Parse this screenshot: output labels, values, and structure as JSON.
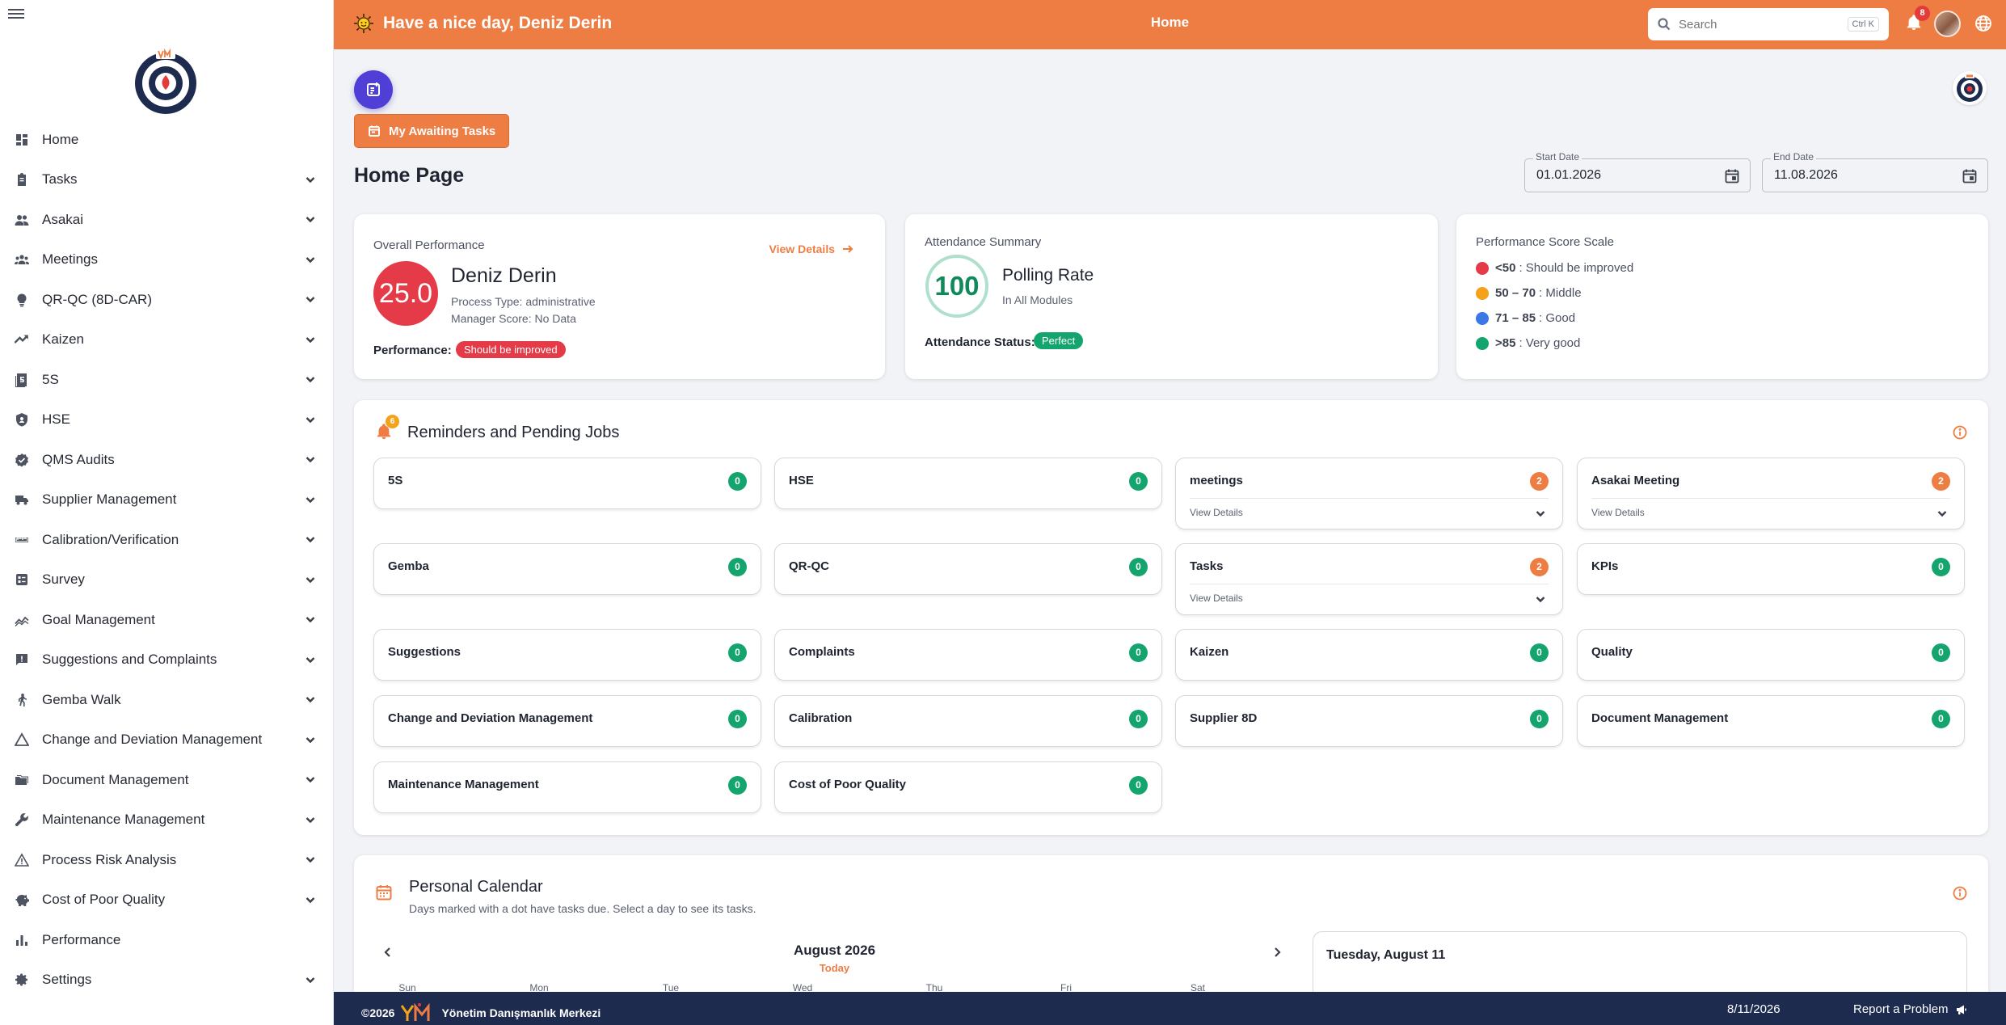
{
  "header": {
    "greeting": "Have a nice day, Deniz Derin",
    "title": "Home",
    "search_placeholder": "Search",
    "search_shortcut": "Ctrl K",
    "notification_count": "8"
  },
  "sidebar": {
    "items": [
      {
        "label": "Home",
        "icon": "dashboard-icon",
        "has_children": false
      },
      {
        "label": "Tasks",
        "icon": "clipboard-icon",
        "has_children": true
      },
      {
        "label": "Asakai",
        "icon": "people-icon",
        "has_children": true
      },
      {
        "label": "Meetings",
        "icon": "groups-icon",
        "has_children": true
      },
      {
        "label": "QR-QC (8D-CAR)",
        "icon": "lightbulb-icon",
        "has_children": true
      },
      {
        "label": "Kaizen",
        "icon": "trending-up-icon",
        "has_children": true
      },
      {
        "label": "5S",
        "icon": "five-icon",
        "has_children": true
      },
      {
        "label": "HSE",
        "icon": "shield-icon",
        "has_children": true
      },
      {
        "label": "QMS Audits",
        "icon": "verified-icon",
        "has_children": true
      },
      {
        "label": "Supplier Management",
        "icon": "truck-icon",
        "has_children": true
      },
      {
        "label": "Calibration/Verification",
        "icon": "ruler-icon",
        "has_children": true
      },
      {
        "label": "Survey",
        "icon": "survey-icon",
        "has_children": true
      },
      {
        "label": "Goal Management",
        "icon": "chart-line-icon",
        "has_children": true
      },
      {
        "label": "Suggestions and Complaints",
        "icon": "feedback-icon",
        "has_children": true
      },
      {
        "label": "Gemba Walk",
        "icon": "walk-icon",
        "has_children": true
      },
      {
        "label": "Change and Deviation Management",
        "icon": "triangle-icon",
        "has_children": true
      },
      {
        "label": "Document Management",
        "icon": "folder-icon",
        "has_children": true
      },
      {
        "label": "Maintenance Management",
        "icon": "wrench-icon",
        "has_children": true
      },
      {
        "label": "Process Risk Analysis",
        "icon": "warning-icon",
        "has_children": true
      },
      {
        "label": "Cost of Poor Quality",
        "icon": "piggy-bank-icon",
        "has_children": true
      },
      {
        "label": "Performance",
        "icon": "bar-chart-icon",
        "has_children": false
      },
      {
        "label": "Settings",
        "icon": "gear-icon",
        "has_children": true
      }
    ]
  },
  "main": {
    "awaiting_tasks_label": "My Awaiting Tasks",
    "page_title": "Home Page",
    "start_date": {
      "label": "Start Date",
      "value": "01.01.2026"
    },
    "end_date": {
      "label": "End Date",
      "value": "11.08.2026"
    }
  },
  "performance": {
    "title": "Overall Performance",
    "view_details": "View Details",
    "score": "25.0",
    "name": "Deniz Derin",
    "process_type": "Process Type: administrative",
    "manager_score": "Manager Score: No Data",
    "performance_label": "Performance:",
    "status": "Should be improved"
  },
  "attendance": {
    "title": "Attendance Summary",
    "value": "100",
    "rate_title": "Polling Rate",
    "rate_sub": "In All Modules",
    "status_label": "Attendance Status:",
    "status": "Perfect"
  },
  "scale": {
    "title": "Performance Score Scale",
    "items": [
      {
        "range": "<50",
        "text": ": Should be improved",
        "color": "#e53a48"
      },
      {
        "range": "50 – 70",
        "text": ": Middle",
        "color": "#f4a21c"
      },
      {
        "range": "71 – 85",
        "text": ": Good",
        "color": "#3a78e6"
      },
      {
        "range": ">85",
        "text": ": Very good",
        "color": "#14a46e"
      }
    ]
  },
  "reminders": {
    "title": "Reminders and Pending Jobs",
    "badge": "6",
    "view_details": "View Details",
    "tiles": [
      {
        "name": "5S",
        "count": "0",
        "expandable": false
      },
      {
        "name": "HSE",
        "count": "0",
        "expandable": false
      },
      {
        "name": "meetings",
        "count": "2",
        "expandable": true
      },
      {
        "name": "Asakai Meeting",
        "count": "2",
        "expandable": true
      },
      {
        "name": "Gemba",
        "count": "0",
        "expandable": false
      },
      {
        "name": "QR-QC",
        "count": "0",
        "expandable": false
      },
      {
        "name": "Tasks",
        "count": "2",
        "expandable": true
      },
      {
        "name": "KPIs",
        "count": "0",
        "expandable": false
      },
      {
        "name": "Suggestions",
        "count": "0",
        "expandable": false
      },
      {
        "name": "Complaints",
        "count": "0",
        "expandable": false
      },
      {
        "name": "Kaizen",
        "count": "0",
        "expandable": false
      },
      {
        "name": "Quality",
        "count": "0",
        "expandable": false
      },
      {
        "name": "Change and Deviation Management",
        "count": "0",
        "expandable": false
      },
      {
        "name": "Calibration",
        "count": "0",
        "expandable": false
      },
      {
        "name": "Supplier 8D",
        "count": "0",
        "expandable": false
      },
      {
        "name": "Document Management",
        "count": "0",
        "expandable": false
      },
      {
        "name": "Maintenance Management",
        "count": "0",
        "expandable": false
      },
      {
        "name": "Cost of Poor Quality",
        "count": "0",
        "expandable": false
      }
    ]
  },
  "calendar": {
    "title": "Personal Calendar",
    "subtitle": "Days marked with a dot have tasks due. Select a day to see its tasks.",
    "month": "August 2026",
    "today": "Today",
    "weekdays": [
      "Sun",
      "Mon",
      "Tue",
      "Wed",
      "Thu",
      "Fri",
      "Sat"
    ],
    "selected_day": "Tuesday, August 11"
  },
  "footer": {
    "copyright": "©2026",
    "company": "Yönetim Danışmanlık Merkezi",
    "date": "8/11/2026",
    "report": "Report a Problem"
  },
  "colors": {
    "accent": "#ee7d43",
    "footer": "#1d2b4f",
    "success": "#14a46e",
    "danger": "#e53a48"
  }
}
